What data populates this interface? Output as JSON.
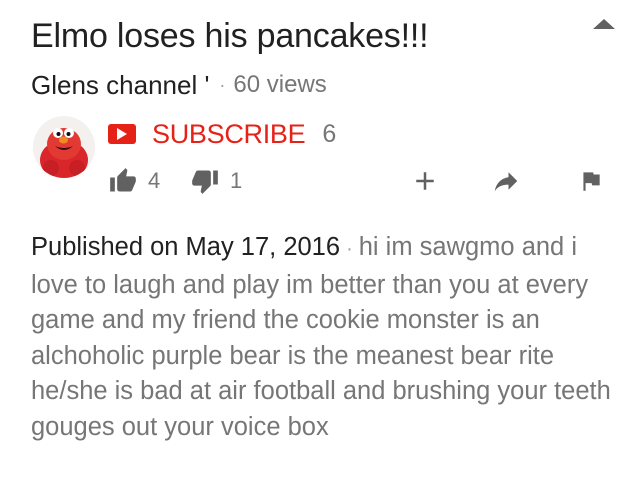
{
  "video": {
    "title": "Elmo loses his pancakes!!!",
    "channel": "Glens channel '",
    "views": "60 views"
  },
  "subscribe": {
    "label": "SUBSCRIBE",
    "count": "6",
    "accent": "#e62117"
  },
  "actions": {
    "like_count": "4",
    "dislike_count": "1",
    "icons": [
      "thumb-up-icon",
      "thumb-down-icon",
      "add-to-playlist-icon",
      "share-icon",
      "flag-icon"
    ]
  },
  "description": {
    "published": "Published on May 17, 2016",
    "text": "hi im sawgmo and i love to laugh and play im better than you at every game and my friend the cookie monster is an alchoholic purple bear is the meanest bear rite he/she is bad at air football and brushing your teeth gouges out your voice box"
  },
  "colors": {
    "primary_text": "#212121",
    "secondary_text": "#767676",
    "icon": "#616161"
  }
}
